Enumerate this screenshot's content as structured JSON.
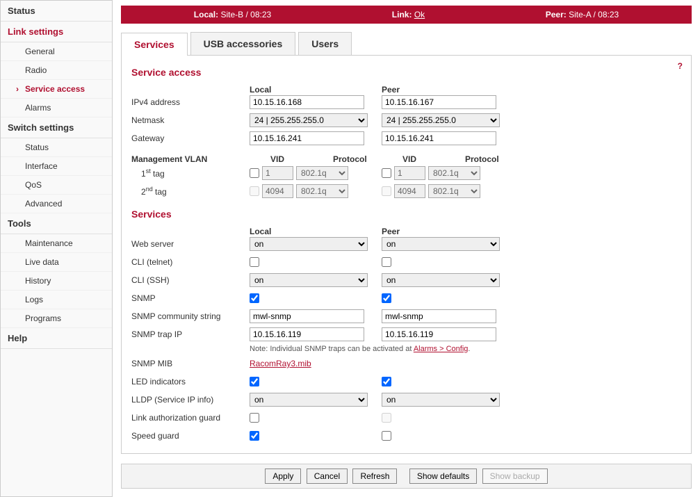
{
  "sidebar": {
    "status": "Status",
    "link_settings": "Link settings",
    "link_items": [
      "General",
      "Radio",
      "Service access",
      "Alarms"
    ],
    "switch_settings": "Switch settings",
    "switch_items": [
      "Status",
      "Interface",
      "QoS",
      "Advanced"
    ],
    "tools": "Tools",
    "tools_items": [
      "Maintenance",
      "Live data",
      "History",
      "Logs",
      "Programs"
    ],
    "help": "Help"
  },
  "topbar": {
    "local_label": "Local:",
    "local_value": "Site-B / 08:23",
    "link_label": "Link:",
    "link_value": "Ok",
    "peer_label": "Peer:",
    "peer_value": "Site-A / 08:23"
  },
  "tabs": [
    "Services",
    "USB accessories",
    "Users"
  ],
  "help_icon": "?",
  "headings": {
    "service_access": "Service access",
    "services": "Services",
    "local": "Local",
    "peer": "Peer"
  },
  "labels": {
    "ipv4": "IPv4 address",
    "netmask": "Netmask",
    "gateway": "Gateway",
    "mvlan": "Management VLAN",
    "vid": "VID",
    "protocol": "Protocol",
    "tag1_pre": "1",
    "tag1_sup": "st",
    "tag_suffix": " tag",
    "tag2_pre": "2",
    "tag2_sup": "nd",
    "web": "Web server",
    "telnet": "CLI (telnet)",
    "ssh": "CLI (SSH)",
    "snmp": "SNMP",
    "community": "SNMP community string",
    "trap": "SNMP trap IP",
    "mib": "SNMP MIB",
    "led": "LED indicators",
    "lldp": "LLDP (Service IP info)",
    "auth": "Link authorization guard",
    "speed": "Speed guard"
  },
  "values": {
    "local": {
      "ipv4": "10.15.16.168",
      "netmask": "24  |  255.255.255.0",
      "gateway": "10.15.16.241",
      "tag1_on": false,
      "tag1_vid": "1",
      "tag1_proto": "802.1q",
      "tag2_on": false,
      "tag2_vid": "4094",
      "tag2_proto": "802.1q",
      "web": "on",
      "telnet": false,
      "ssh": "on",
      "snmp": true,
      "community": "mwl-snmp",
      "trap": "10.15.16.119",
      "led": true,
      "lldp": "on",
      "auth": false,
      "speed": true
    },
    "peer": {
      "ipv4": "10.15.16.167",
      "netmask": "24  |  255.255.255.0",
      "gateway": "10.15.16.241",
      "tag1_on": false,
      "tag1_vid": "1",
      "tag1_proto": "802.1q",
      "tag2_on": false,
      "tag2_vid": "4094",
      "tag2_proto": "802.1q",
      "web": "on",
      "telnet": false,
      "ssh": "on",
      "snmp": true,
      "community": "mwl-snmp",
      "trap": "10.15.16.119",
      "led": true,
      "lldp": "on",
      "auth": false,
      "speed": false
    }
  },
  "note": {
    "text": "Note: Individual SNMP traps can be activated at ",
    "link": "Alarms > Config",
    "dot": "."
  },
  "mib_link": "RacomRay3.mib",
  "buttons": {
    "apply": "Apply",
    "cancel": "Cancel",
    "refresh": "Refresh",
    "defaults": "Show defaults",
    "backup": "Show backup"
  }
}
